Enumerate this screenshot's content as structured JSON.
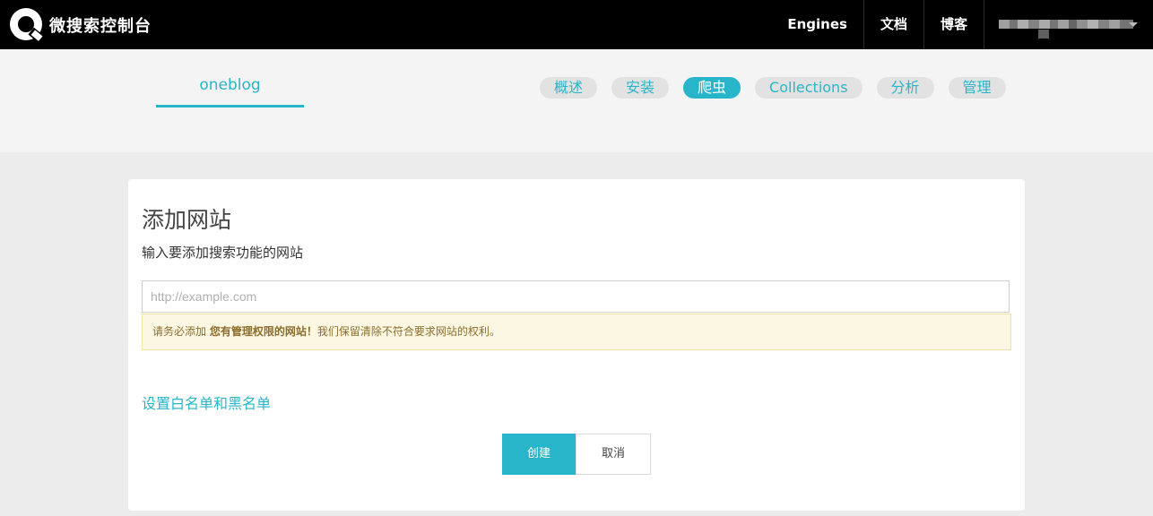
{
  "topbar": {
    "brand": "微搜索控制台",
    "nav": [
      "Engines",
      "文档",
      "博客"
    ]
  },
  "engine": {
    "name": "oneblog"
  },
  "tabs": [
    {
      "label": "概述"
    },
    {
      "label": "安装"
    },
    {
      "label": "爬虫",
      "active": true
    },
    {
      "label": "Collections"
    },
    {
      "label": "分析"
    },
    {
      "label": "管理"
    }
  ],
  "form": {
    "title": "添加网站",
    "subtitle": "输入要添加搜索功能的网站",
    "url_placeholder": "http://example.com",
    "url_value": "",
    "warning_prefix": "请务必添加 ",
    "warning_bold": "您有管理权限的网站！",
    "warning_suffix": "我们保留清除不符合要求网站的权利。",
    "whitelist_link": "设置白名单和黑名单",
    "create_label": "创建",
    "cancel_label": "取消"
  },
  "colors": {
    "accent": "#29b5c9",
    "topbar": "#000000",
    "warning_bg": "#fbf7e3"
  }
}
